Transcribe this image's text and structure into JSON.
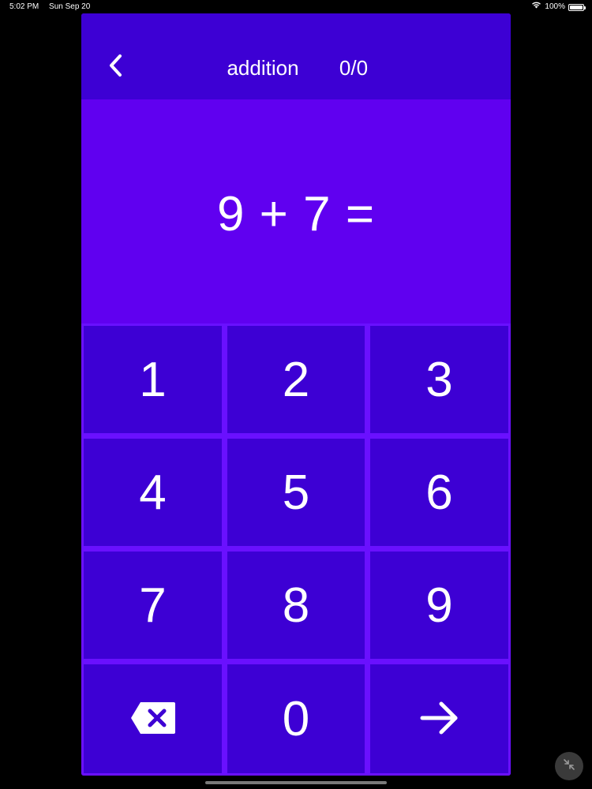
{
  "status_bar": {
    "time": "5:02 PM",
    "date": "Sun Sep 20",
    "battery_text": "100%",
    "battery_level": 1.0,
    "icons": [
      "wifi-icon",
      "battery-icon"
    ]
  },
  "header": {
    "back_icon": "chevron-left-icon",
    "title": "addition",
    "score": "0/0"
  },
  "question": {
    "text": "9 + 7 ="
  },
  "keypad": {
    "keys": [
      "1",
      "2",
      "3",
      "4",
      "5",
      "6",
      "7",
      "8",
      "9"
    ],
    "zero": "0",
    "backspace_icon": "backspace-icon",
    "submit_icon": "arrow-right-icon"
  },
  "colors": {
    "header_bg": "#3d00d4",
    "question_bg": "#6000f0",
    "key_bg": "#3d00d4",
    "grid_line": "#6a10ff",
    "text": "#ffffff",
    "background": "#000000"
  },
  "system": {
    "corner_icon": "collapse-arrows-icon"
  }
}
